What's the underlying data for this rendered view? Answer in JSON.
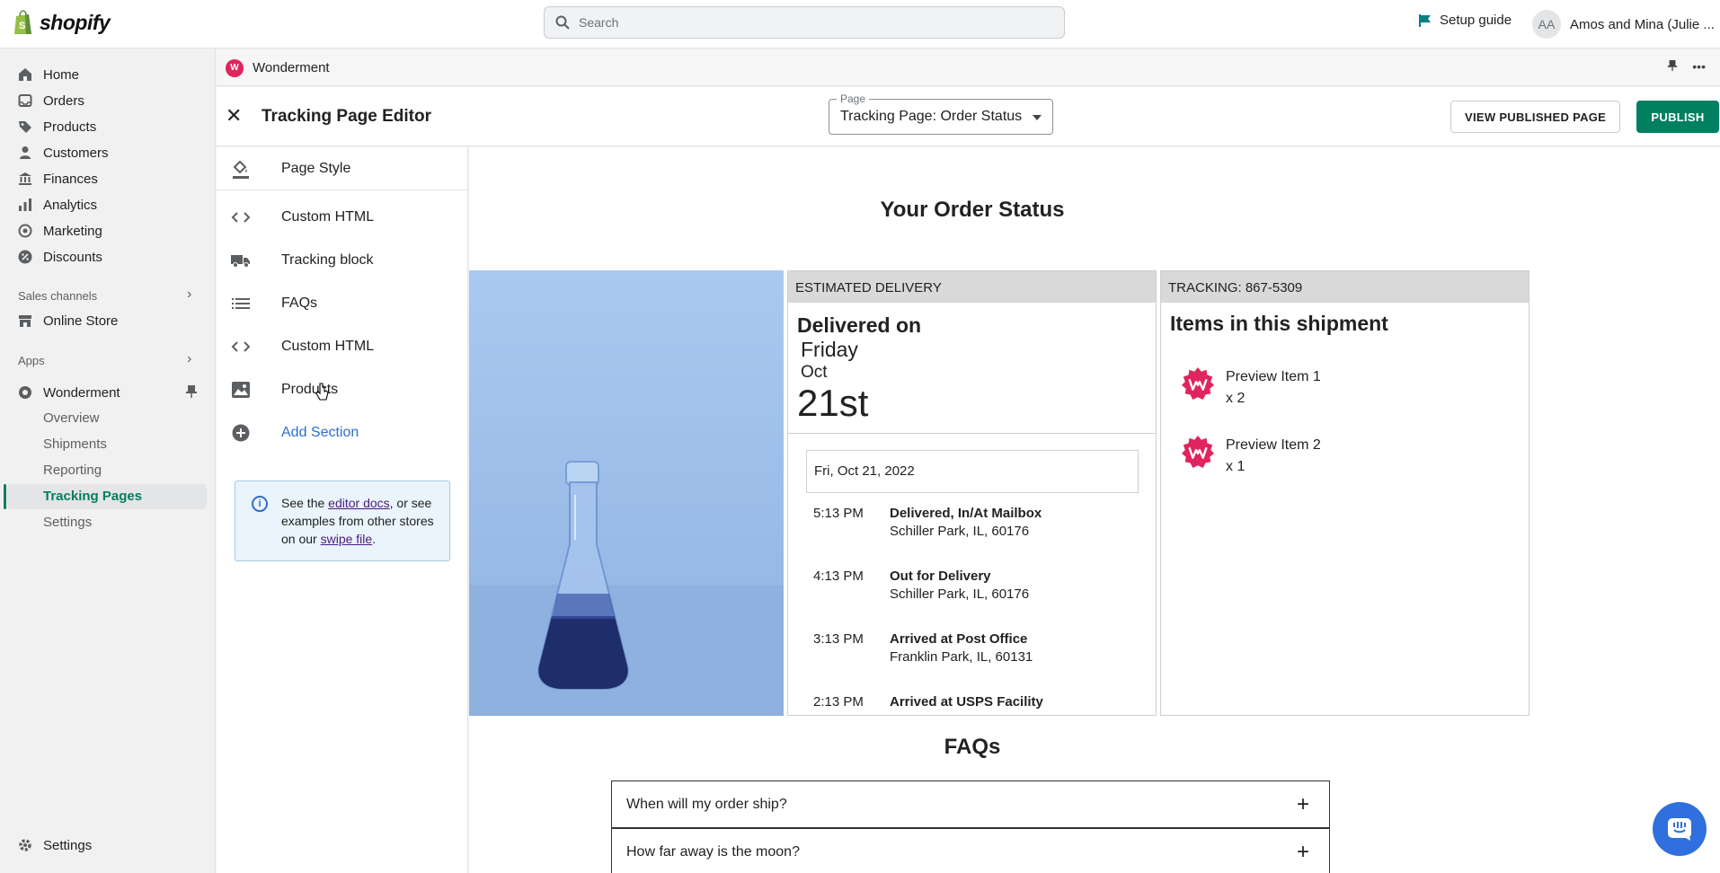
{
  "brand": {
    "name": "shopify",
    "accent": "#008060",
    "app_accent": "#e0245e"
  },
  "topbar": {
    "search_placeholder": "Search",
    "setup_guide": "Setup guide",
    "avatar_initials": "AA",
    "user_name": "Amos and Mina (Julie ..."
  },
  "nav": {
    "items": [
      {
        "label": "Home",
        "icon": "home-icon"
      },
      {
        "label": "Orders",
        "icon": "orders-icon"
      },
      {
        "label": "Products",
        "icon": "tag-icon"
      },
      {
        "label": "Customers",
        "icon": "person-icon"
      },
      {
        "label": "Finances",
        "icon": "bank-icon"
      },
      {
        "label": "Analytics",
        "icon": "bar-chart-icon"
      },
      {
        "label": "Marketing",
        "icon": "target-icon"
      },
      {
        "label": "Discounts",
        "icon": "discount-icon"
      }
    ],
    "sales_channels_label": "Sales channels",
    "online_store": "Online Store",
    "apps_label": "Apps",
    "app_name": "Wonderment",
    "app_subitems": [
      "Overview",
      "Shipments",
      "Reporting",
      "Tracking Pages",
      "Settings"
    ],
    "active_subitem": "Tracking Pages",
    "settings": "Settings"
  },
  "appbar": {
    "title": "Wonderment",
    "logo_letter": "W"
  },
  "editor": {
    "title": "Tracking Page Editor",
    "page_label": "Page",
    "page_value": "Tracking Page: Order Status",
    "view_published": "VIEW PUBLISHED PAGE",
    "publish": "PUBLISH"
  },
  "sections": {
    "items": [
      {
        "label": "Page Style",
        "icon": "paint-bucket-icon"
      },
      {
        "label": "Custom HTML",
        "icon": "code-icon"
      },
      {
        "label": "Tracking block",
        "icon": "truck-icon"
      },
      {
        "label": "FAQs",
        "icon": "list-icon"
      },
      {
        "label": "Custom HTML",
        "icon": "code-icon"
      },
      {
        "label": "Products",
        "icon": "image-icon"
      }
    ],
    "add_section": "Add Section",
    "info": {
      "prefix": "See the ",
      "link1": "editor docs",
      "middle": ", or see examples from other stores on our ",
      "link2": "swipe file",
      "suffix": "."
    }
  },
  "preview": {
    "title": "Your Order Status",
    "delivery": {
      "header": "ESTIMATED DELIVERY",
      "label": "Delivered on",
      "day": "Friday",
      "month": "Oct",
      "date": "21st",
      "date_box": "Fri, Oct 21, 2022",
      "events": [
        {
          "time": "5:13 PM",
          "status": "Delivered, In/At Mailbox",
          "location": "Schiller Park, IL, 60176"
        },
        {
          "time": "4:13 PM",
          "status": "Out for Delivery",
          "location": "Schiller Park, IL, 60176"
        },
        {
          "time": "3:13 PM",
          "status": "Arrived at Post Office",
          "location": "Franklin Park, IL, 60131"
        },
        {
          "time": "2:13 PM",
          "status": "Arrived at USPS Facility",
          "location": ""
        }
      ]
    },
    "shipment": {
      "header": "TRACKING: 867-5309",
      "title": "Items in this shipment",
      "items": [
        {
          "name": "Preview Item 1",
          "qty": "x 2"
        },
        {
          "name": "Preview Item 2",
          "qty": "x 1"
        }
      ]
    },
    "faq_title": "FAQs",
    "faqs": [
      "When will my order ship?",
      "How far away is the moon?"
    ]
  }
}
